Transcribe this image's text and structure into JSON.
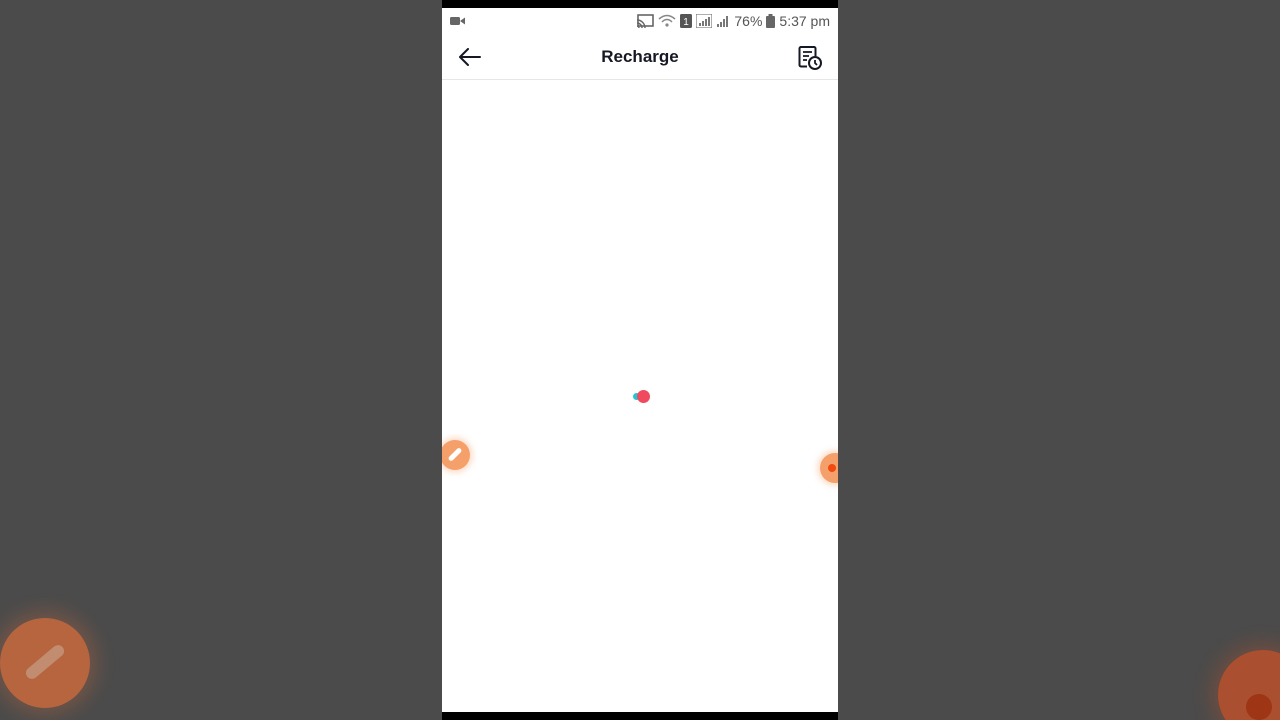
{
  "status_bar": {
    "battery_percent": "76%",
    "time": "5:37 pm",
    "sim_slot": "1"
  },
  "header": {
    "title": "Recharge"
  },
  "icons": {
    "back": "arrow-left-icon",
    "history": "transaction-history-icon",
    "loader": "loading-dots-icon",
    "recorder_brush": "brush-icon",
    "recorder_record": "record-icon"
  },
  "colors": {
    "title": "#161823",
    "loader_cyan": "#25c4d4",
    "loader_red": "#f04a5e",
    "overlay_orange": "#f5a06a"
  }
}
